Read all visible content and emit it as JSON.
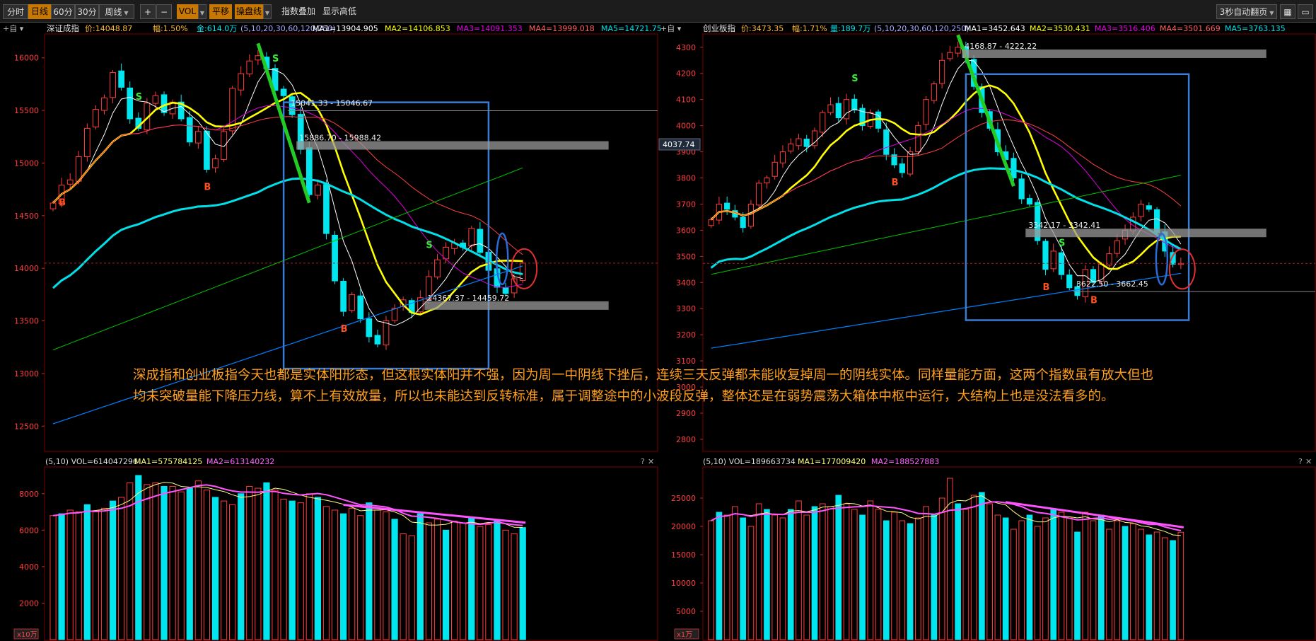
{
  "toolbar": {
    "periods": [
      "分时",
      "日线",
      "60分",
      "30分"
    ],
    "active_period": "日线",
    "period_select": "周线",
    "plus": "+",
    "minus": "−",
    "indicator": "VOL",
    "flat_line": "平移",
    "curve_op": "操盘线",
    "index_overlay": "指数叠加",
    "show_hilo": "显示高低",
    "auto_page": "3秒自动翻页"
  },
  "annotation": {
    "line1": "深成指和创业板指今天也都是实体阳形态，但这根实体阳并不强，因为周一中阴线下挫后，连续三天反弹都未能收复掉周一的阴线实体。同样量能方面，这两个指数虽有放大但也",
    "line2": "均未突破量能下降压力线，算不上有效放量，所以也未能达到反转标准，属于调整途中的小波段反弹，整体还是在弱势震荡大箱体中枢中运行，大结构上也是没法看多的。"
  },
  "colors": {
    "up": "#ff3c3c",
    "down": "#00e5ee",
    "ma1": "#ffffff",
    "ma2": "#ffff00",
    "ma3": "#e000e0",
    "ma4": "#ff4040",
    "ma5": "#00e0e8",
    "ma6": "#00c000",
    "ma7": "#0080ff",
    "box": "#3a7bd5",
    "trend": "#22cc22",
    "volume_line": "#ff55ff"
  },
  "chart_data": [
    {
      "type": "candlestick",
      "name": "深证成指",
      "header": {
        "name": "深证成指",
        "price": "价:14048.87",
        "change": "幅:1.50%",
        "amount": "金:614.0万",
        "params": "(5,10,20,30,60,120,250)",
        "ma1": "MA1=13904.905",
        "ma2": "MA2=14106.853",
        "ma3": "MA3=14091.353",
        "ma4": "MA4=13999.018",
        "ma5": "MA5=14721.75"
      },
      "ylim": [
        12300,
        16200
      ],
      "yticks": [
        "16000",
        "15500",
        "15000",
        "14500",
        "14000",
        "13500",
        "13000",
        "12500"
      ],
      "closes": [
        14620,
        14790,
        14840,
        15060,
        15330,
        15510,
        15620,
        15860,
        15720,
        15420,
        15330,
        15570,
        15640,
        15480,
        15580,
        15420,
        15200,
        15300,
        14940,
        15040,
        15300,
        15710,
        15850,
        15970,
        16020,
        15900,
        15690,
        15640,
        15460,
        15130,
        14700,
        14790,
        14330,
        13880,
        13590,
        13750,
        13520,
        13350,
        13280,
        13500,
        13620,
        13700,
        13580,
        13720,
        13920,
        14080,
        14200,
        14240,
        14200,
        14380,
        14150,
        13980,
        13820,
        13760,
        13900,
        14049
      ],
      "price_levels": [
        {
          "label": "15886.70 - 15988.42"
        },
        {
          "label": "15041.33 - 15046.67"
        },
        {
          "label": "14367.37 - 14459.72"
        }
      ],
      "signals": [
        "B",
        "S",
        "B",
        "S",
        "B",
        "S"
      ],
      "volume": {
        "header": "(5,10)  VOL=614047296",
        "ma1": "MA1=575784125",
        "ma2": "MA2=613140232",
        "unit": "x10万",
        "ylim": [
          0,
          9000
        ],
        "yticks": [
          "8000",
          "6000",
          "4000",
          "2000"
        ],
        "values": [
          6800,
          6900,
          7100,
          7000,
          7400,
          7000,
          7200,
          7600,
          7800,
          8600,
          9000,
          8500,
          8600,
          8400,
          8400,
          8100,
          8300,
          8700,
          8200,
          7800,
          7600,
          7400,
          8000,
          8400,
          8300,
          8600,
          8200,
          7700,
          7600,
          7500,
          8000,
          7800,
          7300,
          7100,
          6900,
          7200,
          6800,
          7500,
          7100,
          7000,
          6600,
          5800,
          5700,
          6900,
          6400,
          6600,
          6000,
          6500,
          6400,
          6700,
          6200,
          6300,
          6500,
          6000,
          5800,
          6140
        ]
      }
    },
    {
      "type": "candlestick",
      "name": "创业板指",
      "header": {
        "name": "创业板指",
        "price": "价:3473.35",
        "change": "幅:1.71%",
        "amount": "量:189.7万",
        "params": "(5,10,20,30,60,120,250)",
        "ma1": "MA1=3452.643",
        "ma2": "MA2=3530.431",
        "ma3": "MA3=3516.406",
        "ma4": "MA4=3501.669",
        "ma5": "MA5=3763.135"
      },
      "ylim": [
        2770,
        4340
      ],
      "yticks": [
        "4300",
        "4200",
        "4100",
        "4000",
        "3900",
        "3800",
        "3700",
        "3600",
        "3500",
        "3400",
        "3300",
        "3200",
        "3100",
        "3000",
        "2900",
        "2800"
      ],
      "current_price_tag": "4037.74",
      "closes": [
        3640,
        3700,
        3680,
        3650,
        3610,
        3700,
        3780,
        3800,
        3860,
        3900,
        3930,
        3950,
        3920,
        3980,
        4050,
        4080,
        4030,
        4100,
        4060,
        4000,
        4050,
        3990,
        3890,
        3850,
        3820,
        3900,
        4000,
        4100,
        4160,
        4250,
        4280,
        4300,
        4260,
        4150,
        4050,
        3990,
        3900,
        3870,
        3800,
        3720,
        3700,
        3560,
        3450,
        3520,
        3430,
        3380,
        3350,
        3450,
        3400,
        3470,
        3510,
        3560,
        3600,
        3650,
        3700,
        3680,
        3590,
        3520,
        3470,
        3473
      ],
      "price_levels": [
        {
          "label": "4168.87 - 4222.22"
        },
        {
          "label": "3622.50 - 3662.45"
        },
        {
          "label": "3342.17 - 3342.41"
        }
      ],
      "signals": [
        "S",
        "B",
        "B",
        "S",
        "B"
      ],
      "volume": {
        "header": "(5,10)  VOL=189663734",
        "ma1": "MA1=177009420",
        "ma2": "MA2=188527883",
        "unit": "x1万",
        "ylim": [
          0,
          29000
        ],
        "yticks": [
          "25000",
          "20000",
          "15000",
          "10000",
          "5000"
        ],
        "values": [
          21000,
          22500,
          22000,
          23500,
          21500,
          20000,
          24000,
          23000,
          22000,
          21500,
          23000,
          24500,
          22000,
          23500,
          24000,
          23500,
          25500,
          24000,
          23000,
          22000,
          24500,
          23000,
          21000,
          22500,
          21000,
          20500,
          21500,
          23500,
          22000,
          25000,
          28500,
          24000,
          23000,
          25500,
          26000,
          24000,
          22000,
          21500,
          19500,
          21000,
          22000,
          20000,
          21500,
          23000,
          22500,
          21500,
          19000,
          22500,
          21000,
          22000,
          19500,
          21000,
          20000,
          20500,
          19500,
          18500,
          19000,
          18000,
          17500,
          18966
        ]
      }
    }
  ]
}
